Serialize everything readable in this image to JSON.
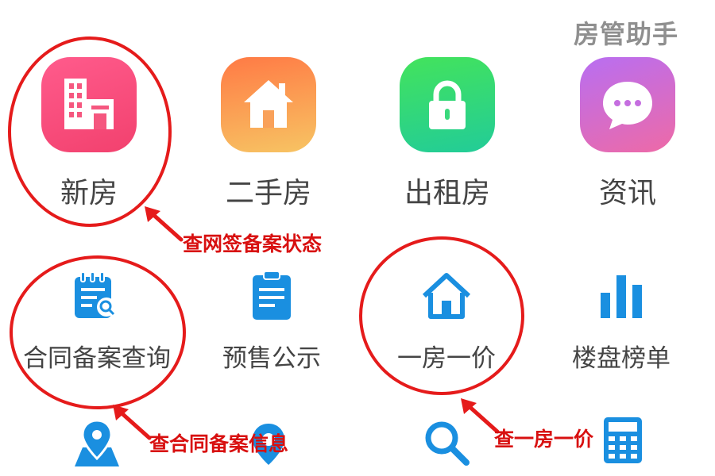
{
  "watermark": "房管助手",
  "apps": [
    {
      "label": "新房",
      "icon": "building-icon",
      "gradient": [
        "#ff5b8c",
        "#f2416e"
      ]
    },
    {
      "label": "二手房",
      "icon": "house-icon",
      "gradient": [
        "#ff7a45",
        "#f7c463"
      ]
    },
    {
      "label": "出租房",
      "icon": "lock-icon",
      "gradient": [
        "#43e35c",
        "#22cc98"
      ]
    },
    {
      "label": "资讯",
      "icon": "chat-bubble-icon",
      "gradient": [
        "#b86ef2",
        "#ee6aa6"
      ]
    }
  ],
  "tools": [
    {
      "label": "合同备案查询",
      "icon": "document-search-icon"
    },
    {
      "label": "预售公示",
      "icon": "clipboard-icon"
    },
    {
      "label": "一房一价",
      "icon": "house-outline-icon"
    },
    {
      "label": "楼盘榜单",
      "icon": "bar-chart-icon"
    }
  ],
  "bottom_icons": [
    "map-pin-icon",
    "location-icon",
    "magnifier-icon",
    "calculator-icon"
  ],
  "annotations": [
    {
      "text": "查网签备案状态"
    },
    {
      "text": "查合同备案信息"
    },
    {
      "text": "查一房一价"
    }
  ],
  "colors": {
    "accent_blue": "#1a8fe0",
    "annotation_red": "#e51b1b",
    "label_gray": "#444444"
  }
}
